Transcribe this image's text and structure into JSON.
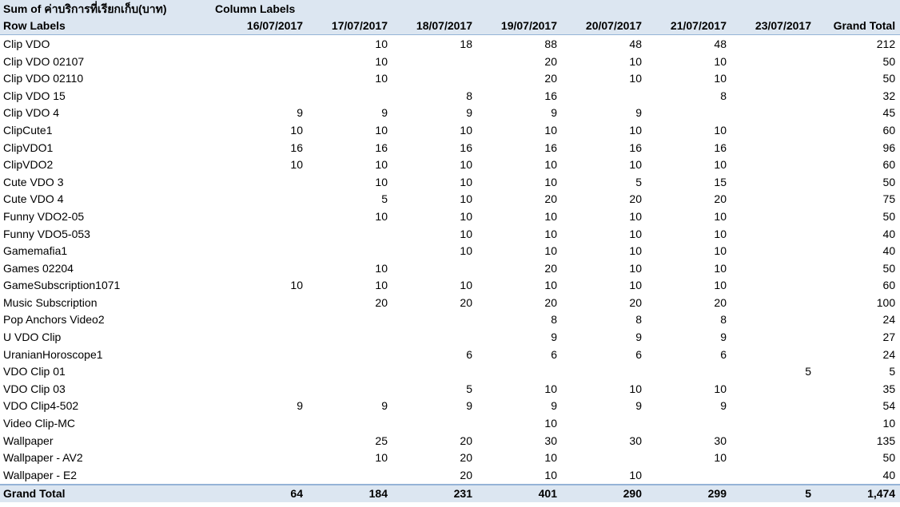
{
  "pivot": {
    "corner_title": "Sum of ค่าบริการที่เรียกเก็บ(บาท)",
    "column_labels_caption": "Column Labels",
    "row_labels_caption": "Row Labels",
    "columns": [
      "16/07/2017",
      "17/07/2017",
      "18/07/2017",
      "19/07/2017",
      "20/07/2017",
      "21/07/2017",
      "23/07/2017",
      "Grand Total"
    ],
    "rows": [
      {
        "label": "Clip VDO",
        "values": [
          "",
          "10",
          "18",
          "88",
          "48",
          "48",
          "",
          "212"
        ]
      },
      {
        "label": "Clip VDO 02107",
        "values": [
          "",
          "10",
          "",
          "20",
          "10",
          "10",
          "",
          "50"
        ]
      },
      {
        "label": "Clip VDO 02110",
        "values": [
          "",
          "10",
          "",
          "20",
          "10",
          "10",
          "",
          "50"
        ]
      },
      {
        "label": "Clip VDO 15",
        "values": [
          "",
          "",
          "8",
          "16",
          "",
          "8",
          "",
          "32"
        ]
      },
      {
        "label": "Clip VDO 4",
        "values": [
          "9",
          "9",
          "9",
          "9",
          "9",
          "",
          "",
          "45"
        ]
      },
      {
        "label": "ClipCute1",
        "values": [
          "10",
          "10",
          "10",
          "10",
          "10",
          "10",
          "",
          "60"
        ]
      },
      {
        "label": "ClipVDO1",
        "values": [
          "16",
          "16",
          "16",
          "16",
          "16",
          "16",
          "",
          "96"
        ]
      },
      {
        "label": "ClipVDO2",
        "values": [
          "10",
          "10",
          "10",
          "10",
          "10",
          "10",
          "",
          "60"
        ]
      },
      {
        "label": "Cute VDO 3",
        "values": [
          "",
          "10",
          "10",
          "10",
          "5",
          "15",
          "",
          "50"
        ]
      },
      {
        "label": "Cute VDO 4",
        "values": [
          "",
          "5",
          "10",
          "20",
          "20",
          "20",
          "",
          "75"
        ]
      },
      {
        "label": "Funny VDO2-05",
        "values": [
          "",
          "10",
          "10",
          "10",
          "10",
          "10",
          "",
          "50"
        ]
      },
      {
        "label": "Funny VDO5-053",
        "values": [
          "",
          "",
          "10",
          "10",
          "10",
          "10",
          "",
          "40"
        ]
      },
      {
        "label": "Gamemafia1",
        "values": [
          "",
          "",
          "10",
          "10",
          "10",
          "10",
          "",
          "40"
        ]
      },
      {
        "label": "Games 02204",
        "values": [
          "",
          "10",
          "",
          "20",
          "10",
          "10",
          "",
          "50"
        ]
      },
      {
        "label": "GameSubscription1071",
        "values": [
          "10",
          "10",
          "10",
          "10",
          "10",
          "10",
          "",
          "60"
        ]
      },
      {
        "label": "Music Subscription",
        "values": [
          "",
          "20",
          "20",
          "20",
          "20",
          "20",
          "",
          "100"
        ]
      },
      {
        "label": "Pop Anchors Video2",
        "values": [
          "",
          "",
          "",
          "8",
          "8",
          "8",
          "",
          "24"
        ]
      },
      {
        "label": "U VDO Clip",
        "values": [
          "",
          "",
          "",
          "9",
          "9",
          "9",
          "",
          "27"
        ]
      },
      {
        "label": "UranianHoroscope1",
        "values": [
          "",
          "",
          "6",
          "6",
          "6",
          "6",
          "",
          "24"
        ]
      },
      {
        "label": "VDO Clip 01",
        "values": [
          "",
          "",
          "",
          "",
          "",
          "",
          "5",
          "5"
        ]
      },
      {
        "label": "VDO Clip 03",
        "values": [
          "",
          "",
          "5",
          "10",
          "10",
          "10",
          "",
          "35"
        ]
      },
      {
        "label": "VDO Clip4-502",
        "values": [
          "9",
          "9",
          "9",
          "9",
          "9",
          "9",
          "",
          "54"
        ]
      },
      {
        "label": "Video Clip-MC",
        "values": [
          "",
          "",
          "",
          "10",
          "",
          "",
          "",
          "10"
        ]
      },
      {
        "label": "Wallpaper",
        "values": [
          "",
          "25",
          "20",
          "30",
          "30",
          "30",
          "",
          "135"
        ]
      },
      {
        "label": "Wallpaper - AV2",
        "values": [
          "",
          "10",
          "20",
          "10",
          "",
          "10",
          "",
          "50"
        ]
      },
      {
        "label": "Wallpaper - E2",
        "values": [
          "",
          "",
          "20",
          "10",
          "10",
          "",
          "",
          "40"
        ]
      }
    ],
    "grand_total": {
      "label": "Grand Total",
      "values": [
        "64",
        "184",
        "231",
        "401",
        "290",
        "299",
        "5",
        "1,474"
      ]
    }
  },
  "colors": {
    "header_fill": "#dce6f1",
    "border": "#95b3d7"
  }
}
